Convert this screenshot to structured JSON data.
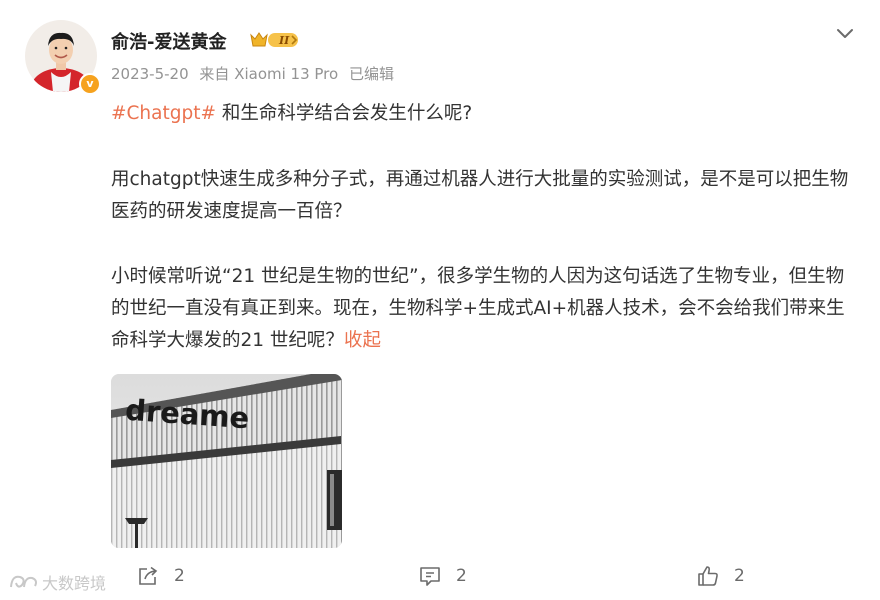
{
  "post": {
    "author": {
      "name": "俞浩-爱送黄金",
      "vip_level": "II",
      "verified_mark": "v"
    },
    "meta": {
      "date": "2023-5-20",
      "source": "来自 Xiaomi 13 Pro",
      "edited": "已编辑"
    },
    "content": {
      "hashtag": "#Chatgpt#",
      "line1_rest": " 和生命科学结合会发生什么呢?",
      "paragraph2": "用chatgpt快速生成多种分子式，再通过机器人进行大批量的实验测试，是不是可以把生物医药的研发速度提高一百倍？",
      "paragraph3": "小时候常听说“21 世纪是生物的世纪”，很多学生物的人因为这句话选了生物专业，但生物的世纪一直没有真正到来。现在，生物科学+生成式AI+机器人技术，会不会给我们带来生命科学大爆发的21 世纪呢？",
      "collapse_label": "收起"
    },
    "image": {
      "sign_text": "dreame"
    },
    "actions": {
      "share_count": "2",
      "comment_count": "2",
      "like_count": "2"
    }
  },
  "watermark": {
    "text": "大数跨境"
  },
  "icons": {
    "more": "chevron-down-icon",
    "share": "share-icon",
    "comment": "comment-icon",
    "like": "thumbs-up-icon"
  },
  "colors": {
    "accent": "#eb7350",
    "text": "#333333",
    "meta": "#939393",
    "action": "#6b6b6b"
  }
}
